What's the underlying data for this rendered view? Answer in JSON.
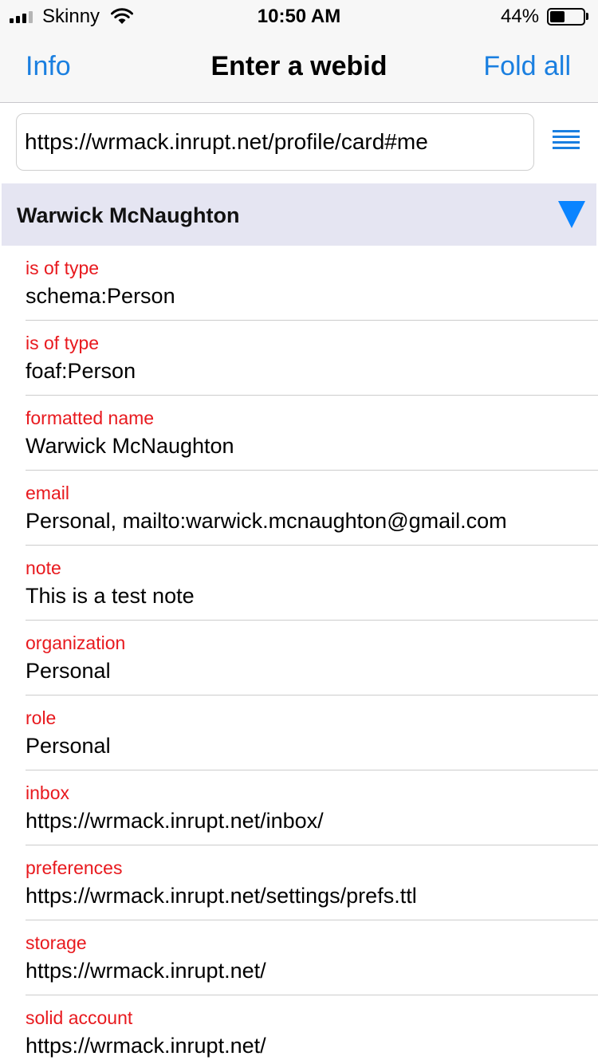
{
  "status_bar": {
    "carrier": "Skinny",
    "time": "10:50 AM",
    "battery_percent": "44%",
    "battery_level": 0.44,
    "signal_bars_filled": 3,
    "signal_bars_total": 4
  },
  "nav": {
    "left_label": "Info",
    "title": "Enter a webid",
    "right_label": "Fold all"
  },
  "webid_input": {
    "value": "https://wrmack.inrupt.net/profile/card#me"
  },
  "menu_icon": "list-icon",
  "section": {
    "title": "Warwick McNaughton",
    "expanded": true
  },
  "properties": [
    {
      "label": "is of type",
      "value": "schema:Person"
    },
    {
      "label": "is of type",
      "value": "foaf:Person"
    },
    {
      "label": "formatted name",
      "value": "Warwick McNaughton"
    },
    {
      "label": "email",
      "value": "Personal, mailto:warwick.mcnaughton@gmail.com"
    },
    {
      "label": "note",
      "value": "This is a test note"
    },
    {
      "label": "organization",
      "value": "Personal"
    },
    {
      "label": "role",
      "value": "Personal"
    },
    {
      "label": "inbox",
      "value": "https://wrmack.inrupt.net/inbox/"
    },
    {
      "label": "preferences",
      "value": "https://wrmack.inrupt.net/settings/prefs.ttl"
    },
    {
      "label": "storage",
      "value": "https://wrmack.inrupt.net/"
    },
    {
      "label": "solid account",
      "value": "https://wrmack.inrupt.net/"
    }
  ],
  "colors": {
    "accent": "#1a7fe0",
    "label_red": "#e8191e",
    "section_bg": "#e5e5f2",
    "triangle": "#0a84ff"
  }
}
